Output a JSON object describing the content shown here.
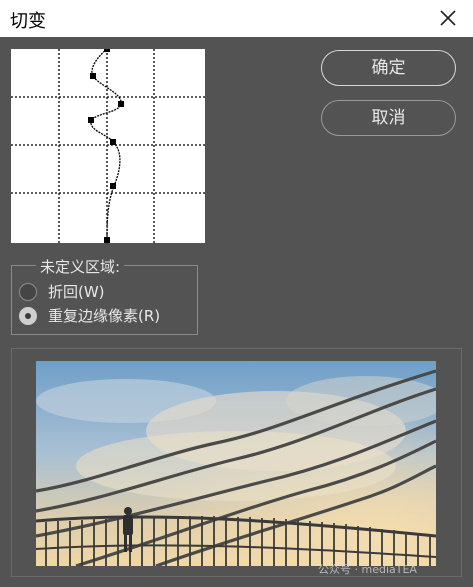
{
  "window": {
    "title": "切变"
  },
  "buttons": {
    "ok": "确定",
    "cancel": "取消"
  },
  "undefined_area": {
    "label": "未定义区域:",
    "options": [
      {
        "label": "折回(W)",
        "selected": false
      },
      {
        "label": "重复边缘像素(R)",
        "selected": true
      }
    ]
  },
  "watermark": "公众号 · mediaTEA",
  "icons": {
    "close": "close-icon"
  }
}
